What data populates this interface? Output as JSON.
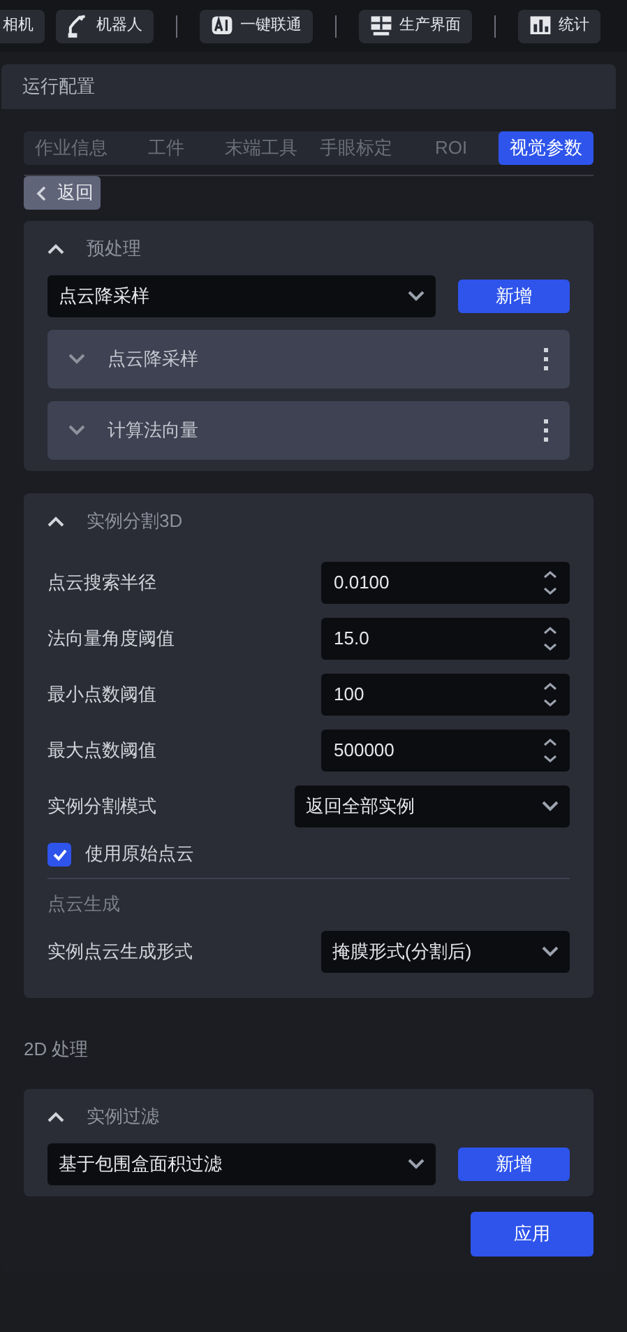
{
  "top_nav": [
    {
      "label": "相机",
      "kind": "plain"
    },
    {
      "label": "机器人",
      "kind": "robot"
    },
    {
      "label": "一键联通",
      "kind": "ai"
    },
    {
      "label": "生产界面",
      "kind": "screen"
    },
    {
      "label": "统计",
      "kind": "chart"
    }
  ],
  "panel": {
    "title": "运行配置",
    "tabs": [
      {
        "label": "作业信息",
        "selected": false
      },
      {
        "label": "工件",
        "selected": false
      },
      {
        "label": "末端工具",
        "selected": false
      },
      {
        "label": "手眼标定",
        "selected": false
      },
      {
        "label": "ROI",
        "selected": false
      },
      {
        "label": "视觉参数",
        "selected": true
      }
    ],
    "back_button": "返回",
    "preprocessing": {
      "title": "预处理",
      "expanded": true,
      "select": "点云降采样",
      "add_button": "新增",
      "items": [
        {
          "label": "点云降采样",
          "expanded": false
        },
        {
          "label": "计算法向量",
          "expanded": false
        }
      ]
    },
    "instance_segmentation": {
      "title": "实例分割3D",
      "expanded": true,
      "fields": [
        {
          "kind": "number",
          "label": "点云搜索半径",
          "value": "0.0100"
        },
        {
          "kind": "number",
          "label": "法向量角度阈值",
          "value": "15.0"
        },
        {
          "kind": "number",
          "label": "最小点数阈值",
          "value": "100"
        },
        {
          "kind": "number",
          "label": "最大点数阈值",
          "value": "500000"
        },
        {
          "kind": "wide_select",
          "label": "实例分割模式",
          "value": "返回全部实例"
        },
        {
          "kind": "checkbox",
          "label": "使用原始点云",
          "checked": true
        }
      ],
      "subsection": {
        "title": "点云生成",
        "fields": [
          {
            "kind": "select",
            "label": "实例点云生成形式",
            "value": "掩膜形式(分割后)"
          }
        ]
      }
    },
    "section_2d": "2D 处理",
    "instance_filter": {
      "title": "实例过滤",
      "expanded": true,
      "select": "基于包围盒面积过滤",
      "add_button": "新增"
    },
    "apply_button": "应用"
  }
}
